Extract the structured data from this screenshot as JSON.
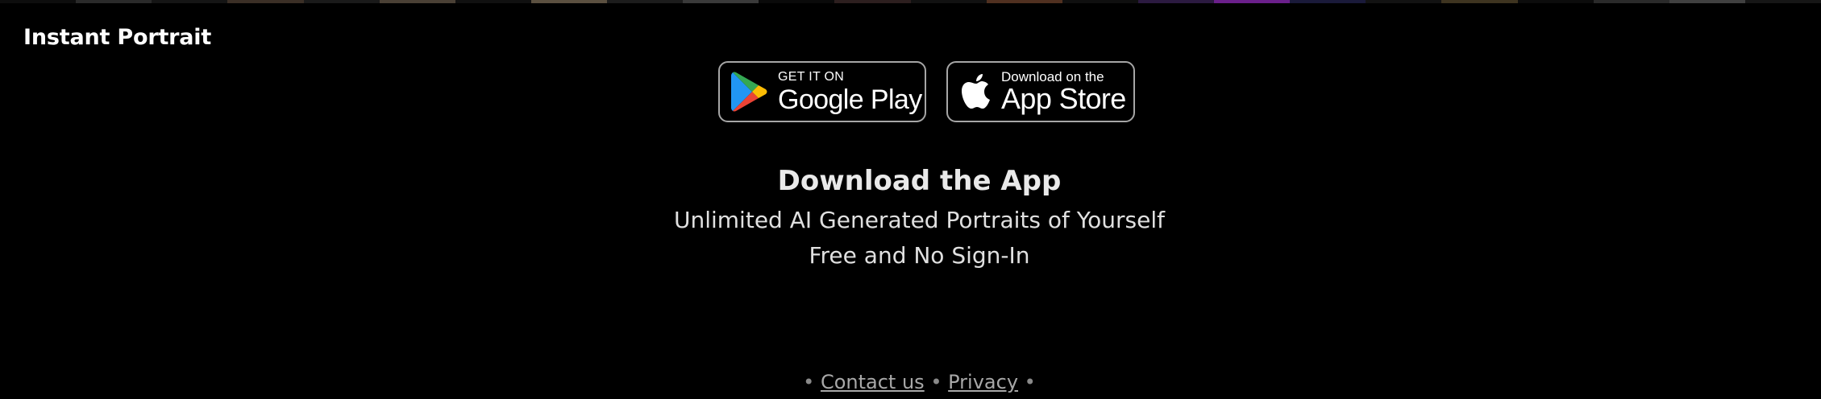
{
  "brand": {
    "name": "Instant Portrait"
  },
  "top_strip": {
    "colors": [
      "#0d0d0d",
      "#2a2a2a",
      "#151515",
      "#3b2f26",
      "#1a1a1a",
      "#4a4035",
      "#101010",
      "#5b5040",
      "#1c1c1c",
      "#3a3a3a",
      "#0a0a0a",
      "#2d1f1f",
      "#111111",
      "#503020",
      "#0f0f0f",
      "#2b1a40",
      "#6a1f8a",
      "#1a1a3a",
      "#121212",
      "#3e3420",
      "#0c0c0c",
      "#2a2a2a",
      "#404040",
      "#161616"
    ]
  },
  "store_badges": {
    "google_play": {
      "small": "GET IT ON",
      "big": "Google Play"
    },
    "app_store": {
      "small": "Download on the",
      "big": "App Store"
    }
  },
  "main": {
    "headline": "Download the App",
    "line1": "Unlimited AI Generated Portraits of Yourself",
    "line2": "Free and No Sign-In"
  },
  "footer": {
    "bullet": "•",
    "contact": "Contact us",
    "privacy": "Privacy"
  }
}
